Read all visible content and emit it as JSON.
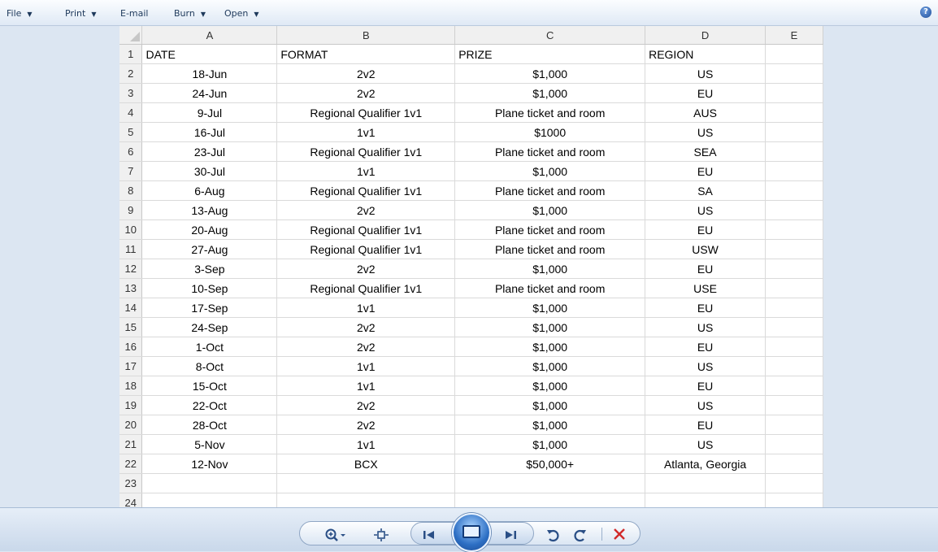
{
  "menubar": {
    "items": [
      {
        "label": "File",
        "has_caret": true
      },
      {
        "label": "Print",
        "has_caret": true
      },
      {
        "label": "E-mail",
        "has_caret": false
      },
      {
        "label": "Burn",
        "has_caret": true
      },
      {
        "label": "Open",
        "has_caret": true
      }
    ],
    "help_icon": "?"
  },
  "sheet": {
    "columns": [
      "A",
      "B",
      "C",
      "D",
      "E"
    ],
    "rows": [
      [
        "1",
        "DATE",
        "FORMAT",
        "PRIZE",
        "REGION",
        ""
      ],
      [
        "2",
        "18-Jun",
        "2v2",
        "$1,000",
        "US",
        ""
      ],
      [
        "3",
        "24-Jun",
        "2v2",
        "$1,000",
        "EU",
        ""
      ],
      [
        "4",
        "9-Jul",
        "Regional Qualifier 1v1",
        "Plane ticket and room",
        "AUS",
        ""
      ],
      [
        "5",
        "16-Jul",
        "1v1",
        "$1000",
        "US",
        ""
      ],
      [
        "6",
        "23-Jul",
        "Regional Qualifier 1v1",
        "Plane ticket and room",
        "SEA",
        ""
      ],
      [
        "7",
        "30-Jul",
        "1v1",
        "$1,000",
        "EU",
        ""
      ],
      [
        "8",
        "6-Aug",
        "Regional Qualifier 1v1",
        "Plane ticket and room",
        "SA",
        ""
      ],
      [
        "9",
        "13-Aug",
        "2v2",
        "$1,000",
        "US",
        ""
      ],
      [
        "10",
        "20-Aug",
        "Regional Qualifier 1v1",
        "Plane ticket and room",
        "EU",
        ""
      ],
      [
        "11",
        "27-Aug",
        "Regional Qualifier 1v1",
        "Plane ticket and room",
        "USW",
        ""
      ],
      [
        "12",
        "3-Sep",
        "2v2",
        "$1,000",
        "EU",
        ""
      ],
      [
        "13",
        "10-Sep",
        "Regional Qualifier 1v1",
        "Plane ticket and room",
        "USE",
        ""
      ],
      [
        "14",
        "17-Sep",
        "1v1",
        "$1,000",
        "EU",
        ""
      ],
      [
        "15",
        "24-Sep",
        "2v2",
        "$1,000",
        "US",
        ""
      ],
      [
        "16",
        "1-Oct",
        "2v2",
        "$1,000",
        "EU",
        ""
      ],
      [
        "17",
        "8-Oct",
        "1v1",
        "$1,000",
        "US",
        ""
      ],
      [
        "18",
        "15-Oct",
        "1v1",
        "$1,000",
        "EU",
        ""
      ],
      [
        "19",
        "22-Oct",
        "2v2",
        "$1,000",
        "US",
        ""
      ],
      [
        "20",
        "28-Oct",
        "2v2",
        "$1,000",
        "EU",
        ""
      ],
      [
        "21",
        "5-Nov",
        "1v1",
        "$1,000",
        "US",
        ""
      ],
      [
        "22",
        "12-Nov",
        "BCX",
        "$50,000+",
        "Atlanta, Georgia",
        ""
      ],
      [
        "23",
        "",
        "",
        "",
        "",
        ""
      ],
      [
        "24",
        "",
        "",
        "",
        "",
        ""
      ]
    ]
  },
  "toolbar": {
    "icons": [
      "zoom-icon",
      "fit-window-icon",
      "previous-icon",
      "slideshow-icon",
      "next-icon",
      "rotate-left-icon",
      "rotate-right-icon",
      "delete-icon"
    ],
    "accent": "#2a4f86",
    "delete_color": "#d12a2a"
  }
}
